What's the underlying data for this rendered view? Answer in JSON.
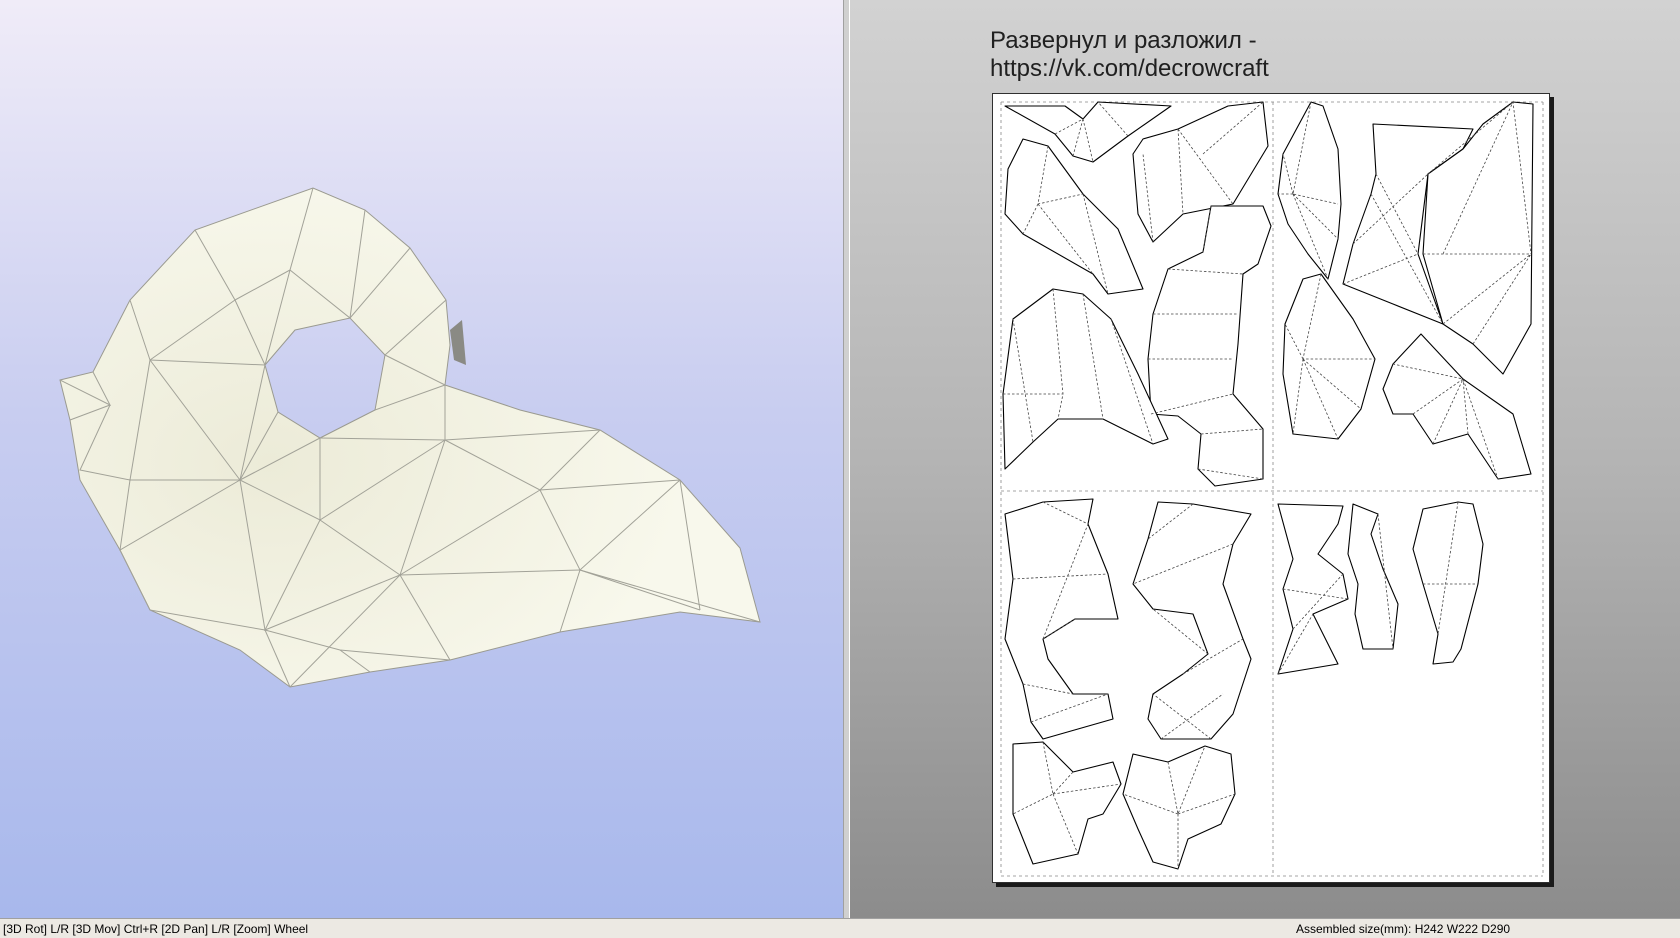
{
  "views": {
    "model_3d": {
      "label": "3D model view",
      "mesh_fill": "#f6f6e8",
      "edge_color": "#9a9a90",
      "background_top": "#f0ecf8",
      "background_bottom": "#a8b8ec"
    },
    "unfold_2d": {
      "caption": "Развернул и разложил -\nhttps://vk.com/decrowcraft",
      "background_top": "#d2d2d2",
      "background_bottom": "#8c8c8c",
      "sheet_color": "#ffffff"
    }
  },
  "statusbar": {
    "hint": "[3D Rot] L/R [3D Mov] Ctrl+R [2D Pan] L/R [Zoom] Wheel",
    "assembled_size": "Assembled size(mm): H242 W222 D290"
  }
}
